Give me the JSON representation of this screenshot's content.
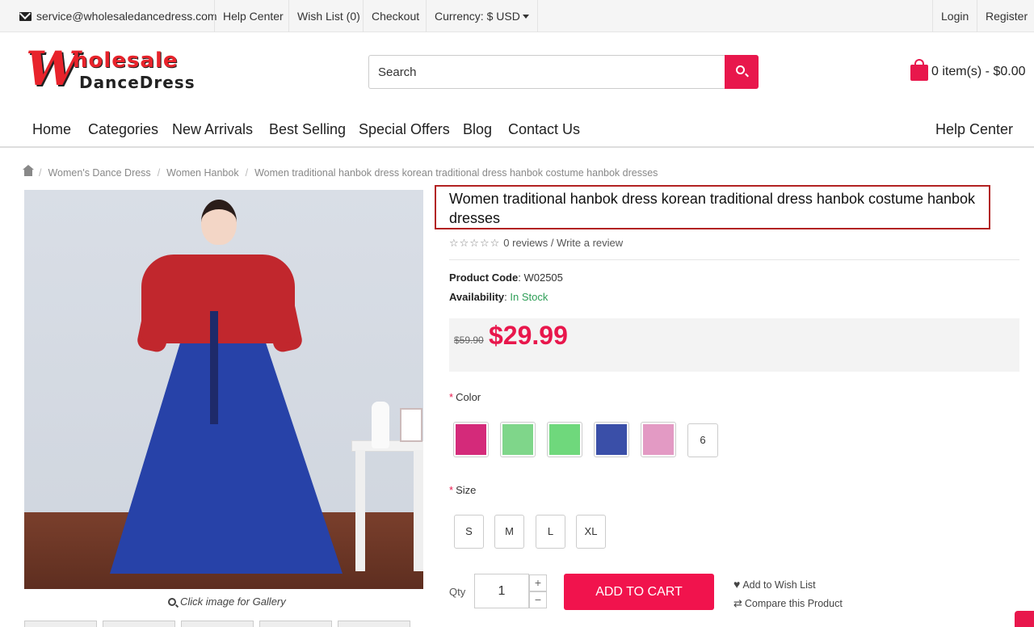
{
  "topbar": {
    "email": "service@wholesaledancedress.com",
    "help": "Help Center",
    "wishlist": "Wish List (0)",
    "checkout": "Checkout",
    "currency": "Currency: $ USD",
    "login": "Login",
    "register": "Register"
  },
  "logo": {
    "big": "W",
    "top": "holesale",
    "bottom": "DanceDress"
  },
  "search": {
    "placeholder": "Search"
  },
  "cart": {
    "summary": "0 item(s) - $0.00"
  },
  "nav": {
    "home": "Home",
    "categories": "Categories",
    "new_arrivals": "New Arrivals",
    "best_selling": "Best Selling",
    "special_offers": "Special Offers",
    "blog": "Blog",
    "contact": "Contact Us",
    "help": "Help Center"
  },
  "breadcrumb": {
    "level1": "Women's Dance Dress",
    "level2": "Women Hanbok",
    "level3": "Women traditional hanbok dress korean traditional dress hanbok costume hanbok dresses"
  },
  "gallery": {
    "caption": "Click image for Gallery"
  },
  "product": {
    "title": "Women traditional hanbok dress korean traditional dress hanbok costume hanbok dresses",
    "reviews": "0 reviews",
    "write_review": "Write a review",
    "code_label": "Product Code",
    "code_value": "W02505",
    "availability_label": "Availability",
    "availability_value": "In Stock",
    "old_price": "$59.90",
    "price": "$29.99",
    "color_label": "Color",
    "colors": [
      "#d42a7a",
      "#7fd68a",
      "#6fd87c",
      "#3a4fa8",
      "#e39ac4"
    ],
    "color_more": "6",
    "size_label": "Size",
    "sizes": [
      "S",
      "M",
      "L",
      "XL"
    ],
    "qty_label": "Qty",
    "qty_value": "1",
    "add_to_cart": "ADD TO CART",
    "add_wishlist": "Add to Wish List",
    "compare": "Compare this Product"
  },
  "colors": {
    "accent": "#e8174c",
    "logo_red": "#e8232b",
    "in_stock": "#2e9e57"
  }
}
